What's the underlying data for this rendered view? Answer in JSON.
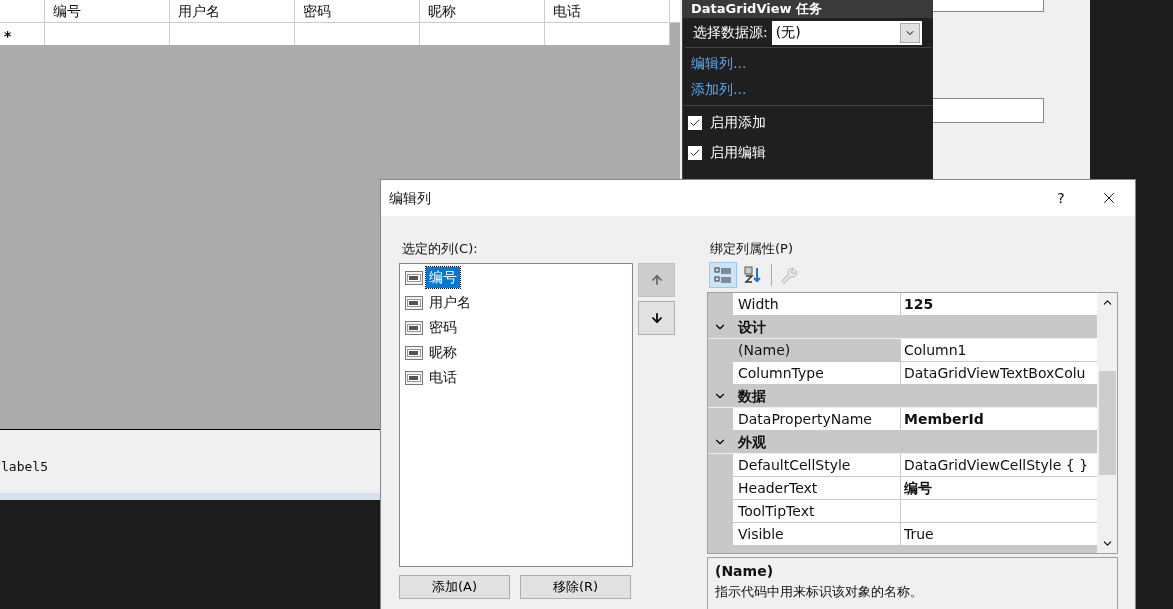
{
  "designer": {
    "grid": {
      "columns": [
        "编号",
        "用户名",
        "密码",
        "昵称",
        "电话"
      ],
      "new_row_marker": "*"
    },
    "label": "label5"
  },
  "smart_tag": {
    "title": "DataGridView 任务",
    "data_source": {
      "label": "选择数据源:",
      "value": "(无)"
    },
    "links": [
      "编辑列...",
      "添加列..."
    ],
    "options": [
      {
        "label": "启用添加",
        "checked": true
      },
      {
        "label": "启用编辑",
        "checked": true
      }
    ]
  },
  "dialog": {
    "title": "编辑列",
    "help": "?",
    "columns_label": "选定的列(C):",
    "columns": [
      {
        "name": "编号",
        "selected": true
      },
      {
        "name": "用户名",
        "selected": false
      },
      {
        "name": "密码",
        "selected": false
      },
      {
        "name": "昵称",
        "selected": false
      },
      {
        "name": "电话",
        "selected": false
      }
    ],
    "properties_label": "绑定列属性(P)",
    "view_buttons": [
      {
        "kind": "categorized",
        "selected": true
      },
      {
        "kind": "alphabetical",
        "selected": false
      }
    ],
    "pages_button": {
      "disabled": true
    },
    "properties": [
      {
        "kind": "property",
        "name": "Width",
        "value": "125",
        "bold": true,
        "selected": false
      },
      {
        "kind": "category",
        "name": "设计",
        "expanded": true
      },
      {
        "kind": "property",
        "name": "(Name)",
        "value": "Column1",
        "bold": false,
        "selected": true
      },
      {
        "kind": "property",
        "name": "ColumnType",
        "value": "DataGridViewTextBoxColu",
        "bold": false,
        "selected": false
      },
      {
        "kind": "category",
        "name": "数据",
        "expanded": true
      },
      {
        "kind": "property",
        "name": "DataPropertyName",
        "value": "MemberId",
        "bold": true,
        "selected": false
      },
      {
        "kind": "category",
        "name": "外观",
        "expanded": true
      },
      {
        "kind": "property",
        "name": "DefaultCellStyle",
        "value": "DataGridViewCellStyle { }",
        "bold": false,
        "selected": false
      },
      {
        "kind": "property",
        "name": "HeaderText",
        "value": "编号",
        "bold": true,
        "selected": false
      },
      {
        "kind": "property",
        "name": "ToolTipText",
        "bold": false,
        "selected": false
      },
      {
        "kind": "property",
        "name": "Visible",
        "value": "True",
        "bold": false,
        "selected": false
      }
    ],
    "description": {
      "title": "(Name)",
      "text": "指示代码中用来标识该对象的名称。"
    },
    "buttons": [
      "添加(A)",
      "移除(R)"
    ]
  }
}
